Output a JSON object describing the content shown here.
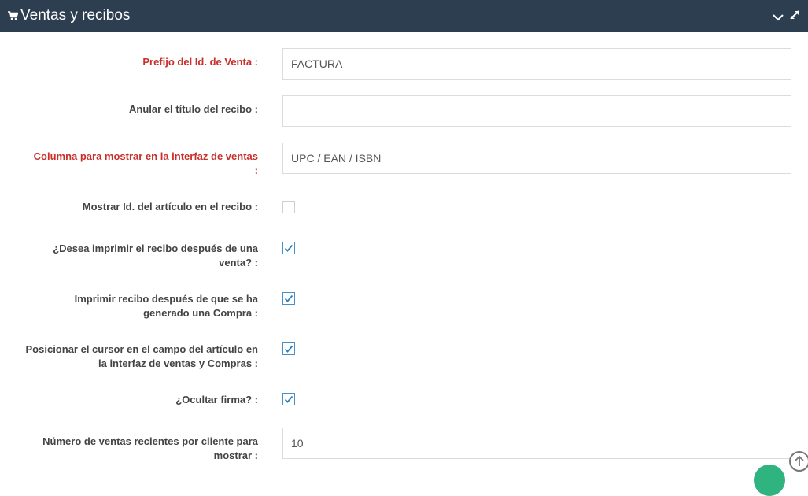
{
  "header": {
    "title": "Ventas y recibos",
    "icons": [
      "cart-icon",
      "chevron-down-icon",
      "expand-icon"
    ]
  },
  "form": {
    "sale_id_prefix": {
      "label": "Prefijo del Id. de Venta :",
      "value": "FACTURA"
    },
    "receipt_title": {
      "label": "Anular el título del recibo :",
      "value": ""
    },
    "sales_column": {
      "label_line1": "Columna para mostrar en la interfaz de ventas",
      "label_line2": ":",
      "value": "UPC / EAN / ISBN"
    },
    "show_item_id": {
      "label": "Mostrar Id. del artículo en el recibo :",
      "checked": false
    },
    "print_after_sale": {
      "label_line1": "¿Desea imprimir el recibo después de una",
      "label_line2": "venta? :",
      "checked": true
    },
    "print_after_purchase": {
      "label_line1": "Imprimir recibo después de que se ha",
      "label_line2": "generado una Compra :",
      "checked": true
    },
    "cursor_position": {
      "label_line1": "Posicionar el cursor en el campo del artículo en",
      "label_line2": "la interfaz de ventas y Compras :",
      "checked": true
    },
    "hide_signature": {
      "label": "¿Ocultar firma? :",
      "checked": true
    },
    "recent_sales": {
      "label_line1": "Número de ventas recientes por cliente para",
      "label_line2": "mostrar :",
      "value": "10"
    }
  },
  "colors": {
    "header_bg": "#2c3e50",
    "required_label": "#c9302c",
    "check": "#2a7fc0"
  }
}
